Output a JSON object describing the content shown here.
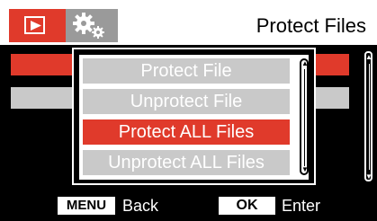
{
  "header": {
    "title": "Protect Files",
    "tabs": [
      {
        "name": "playback",
        "icon": "play-icon",
        "active": true
      },
      {
        "name": "settings",
        "icon": "gears-icon",
        "active": false
      }
    ]
  },
  "dialog": {
    "options": [
      {
        "label": "Protect File",
        "selected": false
      },
      {
        "label": "Unprotect File",
        "selected": false
      },
      {
        "label": "Protect ALL Files",
        "selected": true
      },
      {
        "label": "Unprotect ALL Files",
        "selected": false
      }
    ]
  },
  "footer": {
    "menu_key": "MENU",
    "back_label": "Back",
    "ok_key": "OK",
    "enter_label": "Enter"
  },
  "colors": {
    "accent": "#e03a2b",
    "option_bg": "#c9c9c9",
    "tab_inactive": "#9a9a9a"
  }
}
